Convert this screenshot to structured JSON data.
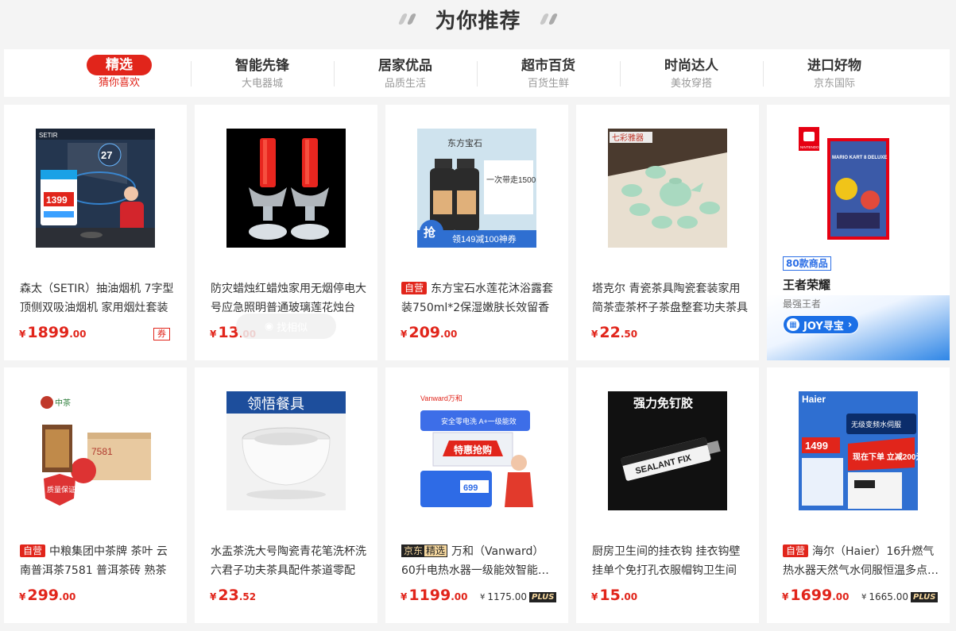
{
  "header": {
    "title": "为你推荐"
  },
  "tabs": [
    {
      "main": "精选",
      "sub": "猜你喜欢",
      "active": true
    },
    {
      "main": "智能先锋",
      "sub": "大电器城"
    },
    {
      "main": "居家优品",
      "sub": "品质生活"
    },
    {
      "main": "超市百货",
      "sub": "百货生鲜"
    },
    {
      "main": "时尚达人",
      "sub": "美妆穿搭"
    },
    {
      "main": "进口好物",
      "sub": "京东国际"
    }
  ],
  "products": [
    {
      "tag": "",
      "name": "森太（SETIR）抽油烟机 7字型顶侧双吸油烟机 家用烟灶套装",
      "price_int": "1899",
      "price_dec": ".00",
      "coupon": "券"
    },
    {
      "tag": "",
      "name": "防灾蜡烛红蜡烛家用无烟停电大号应急照明普通玻璃莲花烛台",
      "price_int": "13",
      "price_dec": ".00",
      "similar": "找相似"
    },
    {
      "tag": "自营",
      "name": "东方宝石水莲花沐浴露套装750ml*2保湿嫩肤长效留香",
      "price_int": "209",
      "price_dec": ".00"
    },
    {
      "tag": "",
      "name": "塔克尔 青瓷茶具陶瓷套装家用简茶壶茶杯子茶盘整套功夫茶具",
      "price_int": "22",
      "price_dec": ".50"
    },
    {
      "tag": "自营",
      "name": "中粮集团中茶牌 茶叶 云南普洱茶7581 普洱茶砖 熟茶",
      "price_int": "299",
      "price_dec": ".00"
    },
    {
      "tag": "",
      "name": "水盂茶洗大号陶瓷青花笔洗杯洗六君子功夫茶具配件茶道零配",
      "price_int": "23",
      "price_dec": ".52"
    },
    {
      "tag": "京东精选",
      "tag_a": "京东",
      "tag_b": "精选",
      "name": "万和（Vanward）60升电热水器一级能效智能变频速热",
      "price_int": "1199",
      "price_dec": ".00",
      "plus_price": "1175.00",
      "plus": "PLUS"
    },
    {
      "tag": "",
      "name": "厨房卫生间的挂衣钩 挂衣钩壁挂单个免打孔衣服帽钩卫生间",
      "price_int": "15",
      "price_dec": ".00"
    },
    {
      "tag": "自营",
      "name": "海尔（Haier）16升燃气热水器天然气水伺服恒温多点用水",
      "price_int": "1699",
      "price_dec": ".00",
      "plus_price": "1665.00",
      "plus": "PLUS"
    }
  ],
  "image_texts": {
    "p1_speed": "27",
    "p1_price": "1399",
    "p3_brand": "东方宝石",
    "p3_promo": "一次带走1500ml",
    "p3_grab": "抢",
    "p3_coupon": "领149减100神券",
    "p4_label": "七彩雅器",
    "p5_brand": "中茶",
    "p5_box": "7581",
    "p5_seal": "质量保证",
    "p6_label": "领悟餐具",
    "p7_brand": "Vanward万和",
    "p7_safe": "安全零电洗 A+一级能效",
    "p7_promo": "特惠抢购",
    "p7_price": "699",
    "p8_label": "强力免钉胶",
    "p8_tube": "SEALANT FIX",
    "p9_brand": "Haier",
    "p9_price": "1499",
    "p9_promo": "现在下单 立减200元",
    "p9_tag": "无级变频水伺服"
  },
  "ad": {
    "badge": "80款商品",
    "title": "王者荣耀",
    "sub": "最强王者",
    "button": "JOY寻宝",
    "icon": "gift-icon",
    "brand": "NINTENDO SWITCH",
    "cover": "MARIO KART 8 DELUXE"
  },
  "colors": {
    "accent": "#e1251b",
    "ad_blue": "#1b6fe6"
  },
  "currency": "¥"
}
